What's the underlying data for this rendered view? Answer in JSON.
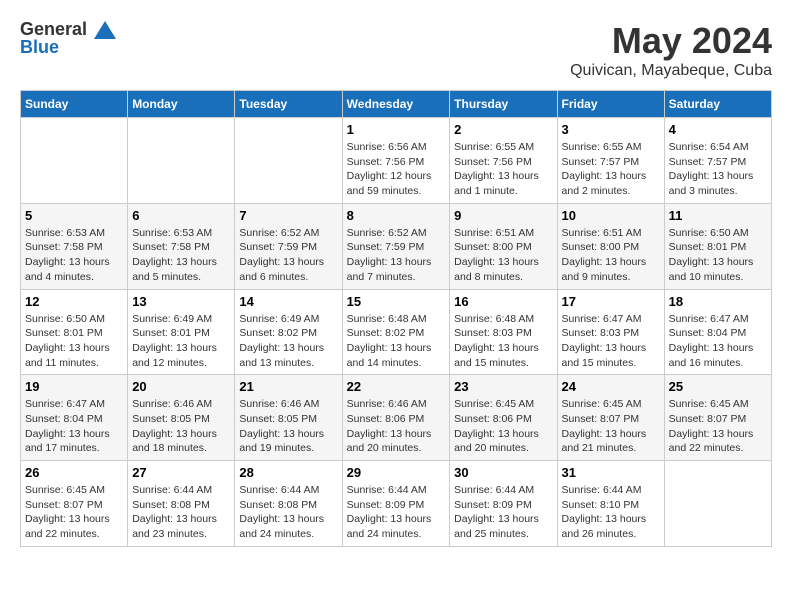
{
  "header": {
    "logo_general": "General",
    "logo_blue": "Blue",
    "month_title": "May 2024",
    "location": "Quivican, Mayabeque, Cuba"
  },
  "weekdays": [
    "Sunday",
    "Monday",
    "Tuesday",
    "Wednesday",
    "Thursday",
    "Friday",
    "Saturday"
  ],
  "weeks": [
    [
      {
        "day": "",
        "sunrise": "",
        "sunset": "",
        "daylight": ""
      },
      {
        "day": "",
        "sunrise": "",
        "sunset": "",
        "daylight": ""
      },
      {
        "day": "",
        "sunrise": "",
        "sunset": "",
        "daylight": ""
      },
      {
        "day": "1",
        "sunrise": "Sunrise: 6:56 AM",
        "sunset": "Sunset: 7:56 PM",
        "daylight": "Daylight: 12 hours and 59 minutes."
      },
      {
        "day": "2",
        "sunrise": "Sunrise: 6:55 AM",
        "sunset": "Sunset: 7:56 PM",
        "daylight": "Daylight: 13 hours and 1 minute."
      },
      {
        "day": "3",
        "sunrise": "Sunrise: 6:55 AM",
        "sunset": "Sunset: 7:57 PM",
        "daylight": "Daylight: 13 hours and 2 minutes."
      },
      {
        "day": "4",
        "sunrise": "Sunrise: 6:54 AM",
        "sunset": "Sunset: 7:57 PM",
        "daylight": "Daylight: 13 hours and 3 minutes."
      }
    ],
    [
      {
        "day": "5",
        "sunrise": "Sunrise: 6:53 AM",
        "sunset": "Sunset: 7:58 PM",
        "daylight": "Daylight: 13 hours and 4 minutes."
      },
      {
        "day": "6",
        "sunrise": "Sunrise: 6:53 AM",
        "sunset": "Sunset: 7:58 PM",
        "daylight": "Daylight: 13 hours and 5 minutes."
      },
      {
        "day": "7",
        "sunrise": "Sunrise: 6:52 AM",
        "sunset": "Sunset: 7:59 PM",
        "daylight": "Daylight: 13 hours and 6 minutes."
      },
      {
        "day": "8",
        "sunrise": "Sunrise: 6:52 AM",
        "sunset": "Sunset: 7:59 PM",
        "daylight": "Daylight: 13 hours and 7 minutes."
      },
      {
        "day": "9",
        "sunrise": "Sunrise: 6:51 AM",
        "sunset": "Sunset: 8:00 PM",
        "daylight": "Daylight: 13 hours and 8 minutes."
      },
      {
        "day": "10",
        "sunrise": "Sunrise: 6:51 AM",
        "sunset": "Sunset: 8:00 PM",
        "daylight": "Daylight: 13 hours and 9 minutes."
      },
      {
        "day": "11",
        "sunrise": "Sunrise: 6:50 AM",
        "sunset": "Sunset: 8:01 PM",
        "daylight": "Daylight: 13 hours and 10 minutes."
      }
    ],
    [
      {
        "day": "12",
        "sunrise": "Sunrise: 6:50 AM",
        "sunset": "Sunset: 8:01 PM",
        "daylight": "Daylight: 13 hours and 11 minutes."
      },
      {
        "day": "13",
        "sunrise": "Sunrise: 6:49 AM",
        "sunset": "Sunset: 8:01 PM",
        "daylight": "Daylight: 13 hours and 12 minutes."
      },
      {
        "day": "14",
        "sunrise": "Sunrise: 6:49 AM",
        "sunset": "Sunset: 8:02 PM",
        "daylight": "Daylight: 13 hours and 13 minutes."
      },
      {
        "day": "15",
        "sunrise": "Sunrise: 6:48 AM",
        "sunset": "Sunset: 8:02 PM",
        "daylight": "Daylight: 13 hours and 14 minutes."
      },
      {
        "day": "16",
        "sunrise": "Sunrise: 6:48 AM",
        "sunset": "Sunset: 8:03 PM",
        "daylight": "Daylight: 13 hours and 15 minutes."
      },
      {
        "day": "17",
        "sunrise": "Sunrise: 6:47 AM",
        "sunset": "Sunset: 8:03 PM",
        "daylight": "Daylight: 13 hours and 15 minutes."
      },
      {
        "day": "18",
        "sunrise": "Sunrise: 6:47 AM",
        "sunset": "Sunset: 8:04 PM",
        "daylight": "Daylight: 13 hours and 16 minutes."
      }
    ],
    [
      {
        "day": "19",
        "sunrise": "Sunrise: 6:47 AM",
        "sunset": "Sunset: 8:04 PM",
        "daylight": "Daylight: 13 hours and 17 minutes."
      },
      {
        "day": "20",
        "sunrise": "Sunrise: 6:46 AM",
        "sunset": "Sunset: 8:05 PM",
        "daylight": "Daylight: 13 hours and 18 minutes."
      },
      {
        "day": "21",
        "sunrise": "Sunrise: 6:46 AM",
        "sunset": "Sunset: 8:05 PM",
        "daylight": "Daylight: 13 hours and 19 minutes."
      },
      {
        "day": "22",
        "sunrise": "Sunrise: 6:46 AM",
        "sunset": "Sunset: 8:06 PM",
        "daylight": "Daylight: 13 hours and 20 minutes."
      },
      {
        "day": "23",
        "sunrise": "Sunrise: 6:45 AM",
        "sunset": "Sunset: 8:06 PM",
        "daylight": "Daylight: 13 hours and 20 minutes."
      },
      {
        "day": "24",
        "sunrise": "Sunrise: 6:45 AM",
        "sunset": "Sunset: 8:07 PM",
        "daylight": "Daylight: 13 hours and 21 minutes."
      },
      {
        "day": "25",
        "sunrise": "Sunrise: 6:45 AM",
        "sunset": "Sunset: 8:07 PM",
        "daylight": "Daylight: 13 hours and 22 minutes."
      }
    ],
    [
      {
        "day": "26",
        "sunrise": "Sunrise: 6:45 AM",
        "sunset": "Sunset: 8:07 PM",
        "daylight": "Daylight: 13 hours and 22 minutes."
      },
      {
        "day": "27",
        "sunrise": "Sunrise: 6:44 AM",
        "sunset": "Sunset: 8:08 PM",
        "daylight": "Daylight: 13 hours and 23 minutes."
      },
      {
        "day": "28",
        "sunrise": "Sunrise: 6:44 AM",
        "sunset": "Sunset: 8:08 PM",
        "daylight": "Daylight: 13 hours and 24 minutes."
      },
      {
        "day": "29",
        "sunrise": "Sunrise: 6:44 AM",
        "sunset": "Sunset: 8:09 PM",
        "daylight": "Daylight: 13 hours and 24 minutes."
      },
      {
        "day": "30",
        "sunrise": "Sunrise: 6:44 AM",
        "sunset": "Sunset: 8:09 PM",
        "daylight": "Daylight: 13 hours and 25 minutes."
      },
      {
        "day": "31",
        "sunrise": "Sunrise: 6:44 AM",
        "sunset": "Sunset: 8:10 PM",
        "daylight": "Daylight: 13 hours and 26 minutes."
      },
      {
        "day": "",
        "sunrise": "",
        "sunset": "",
        "daylight": ""
      }
    ]
  ]
}
